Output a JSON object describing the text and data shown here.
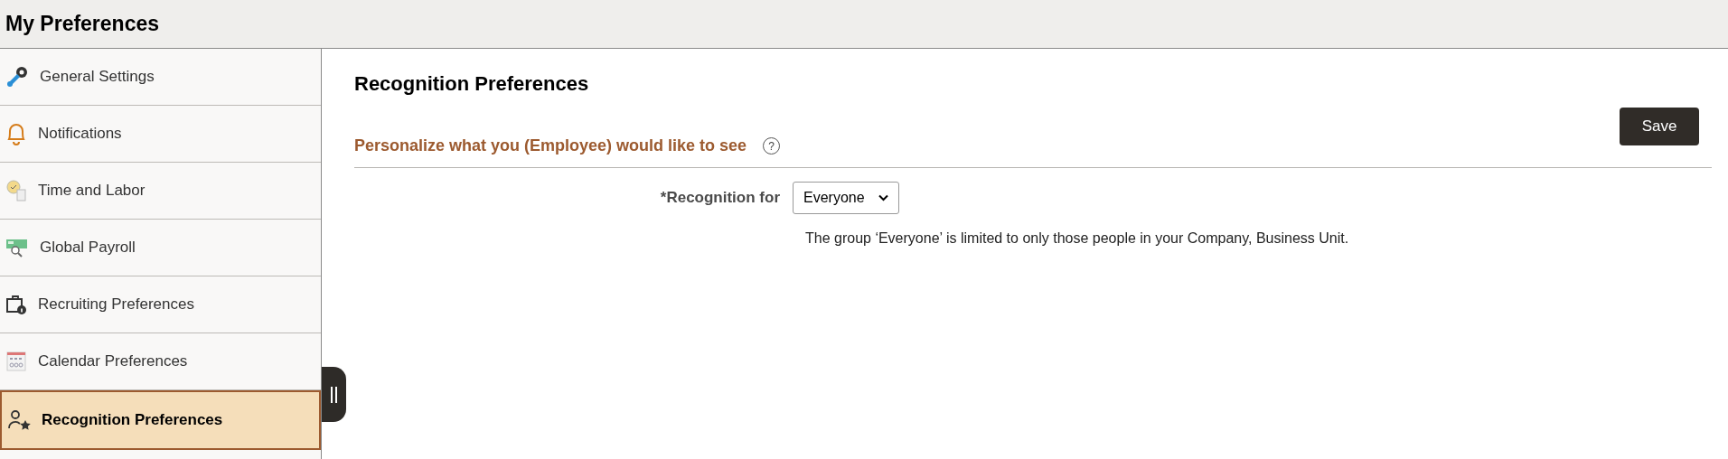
{
  "header": {
    "title": "My Preferences"
  },
  "sidebar": {
    "items": [
      {
        "label": "General Settings",
        "selected": false
      },
      {
        "label": "Notifications",
        "selected": false
      },
      {
        "label": "Time and Labor",
        "selected": false
      },
      {
        "label": "Global Payroll",
        "selected": false
      },
      {
        "label": "Recruiting Preferences",
        "selected": false
      },
      {
        "label": "Calendar Preferences",
        "selected": false
      },
      {
        "label": "Recognition Preferences",
        "selected": true
      }
    ]
  },
  "content": {
    "title": "Recognition Preferences",
    "save_button": "Save",
    "section_heading": "Personalize what you (Employee) would like to see",
    "help_icon": "?",
    "field": {
      "label": "*Recognition for",
      "value": "Everyone",
      "note": "The group ‘Everyone’ is limited to only those people in your Company, Business Unit."
    }
  }
}
